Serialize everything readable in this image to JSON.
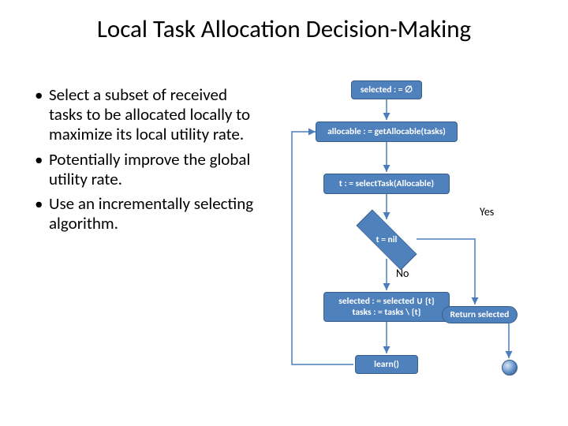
{
  "title": "Local Task Allocation Decision-Making",
  "bullets": {
    "b1": "Select a subset of received tasks to be allocated locally to maximize its local utility rate.",
    "b2": "Potentially improve the global utility rate.",
    "b3": "Use an incrementally selecting algorithm."
  },
  "flow": {
    "n1": "selected : = ∅",
    "n2": "allocable : = getAllocable(tasks)",
    "n3": "t : = selectTask(Allocable)",
    "decision": "t = nil",
    "yes": "Yes",
    "no": "No",
    "n4_line1": "selected : = selected ∪ {t}",
    "n4_line2": "tasks : = tasks \\ {t}",
    "n5": "learn()",
    "ret": "Return selected"
  }
}
